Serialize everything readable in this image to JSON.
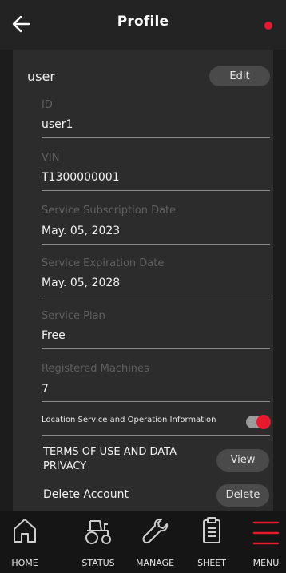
{
  "header": {
    "title": "Profile"
  },
  "profile": {
    "name": "user",
    "edit_label": "Edit"
  },
  "fields": [
    {
      "label": "ID",
      "value": "user1"
    },
    {
      "label": "VIN",
      "value": "T1300000001"
    },
    {
      "label": "Service Subscription Date",
      "value": "May. 05, 2023"
    },
    {
      "label": "Service Expiration Date",
      "value": "May. 05, 2028"
    },
    {
      "label": "Service Plan",
      "value": "Free"
    },
    {
      "label": "Registered Machines",
      "value": "7"
    }
  ],
  "location_toggle": {
    "label": "Location Service and Operation Information",
    "state": "on"
  },
  "terms": {
    "label": "TERMS OF USE AND DATA PRIVACY",
    "button_label": "View"
  },
  "delete_account": {
    "label": "Delete Account",
    "button_label": "Delete"
  },
  "nav": [
    {
      "label": "HOME",
      "icon": "home-icon"
    },
    {
      "label": "STATUS",
      "icon": "tractor-icon"
    },
    {
      "label": "MANAGE",
      "icon": "wrench-icon"
    },
    {
      "label": "SHEET",
      "icon": "clipboard-icon"
    },
    {
      "label": "MENU",
      "icon": "hamburger-menu-icon"
    }
  ],
  "colors": {
    "accent": "#e8192c",
    "background": "#1c1c1c",
    "card": "#2c2c2c"
  }
}
